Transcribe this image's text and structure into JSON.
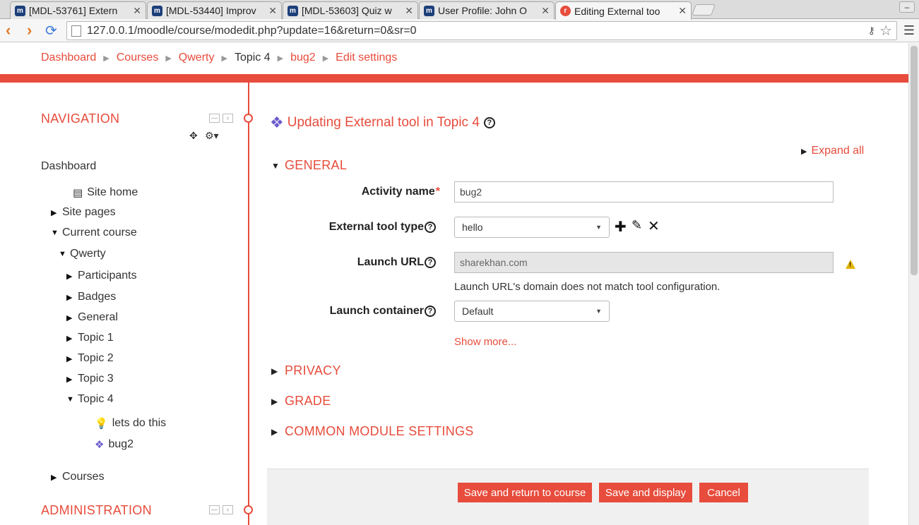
{
  "browser": {
    "tabs": [
      {
        "title": "[MDL-53761] Extern",
        "favicon": "moodle-tracker-icon",
        "active": false
      },
      {
        "title": "[MDL-53440] Improv",
        "favicon": "moodle-tracker-icon",
        "active": false
      },
      {
        "title": "[MDL-53603] Quiz w",
        "favicon": "moodle-tracker-icon",
        "active": false
      },
      {
        "title": "User Profile: John O",
        "favicon": "moodle-tracker-icon",
        "active": false
      },
      {
        "title": "Editing External too",
        "favicon": "moodle-site-icon",
        "active": true
      }
    ],
    "url": "127.0.0.1/moodle/course/modedit.php?update=16&return=0&sr=0"
  },
  "breadcrumb": [
    {
      "label": "Dashboard",
      "link": true
    },
    {
      "label": "Courses",
      "link": true
    },
    {
      "label": "Qwerty",
      "link": true
    },
    {
      "label": "Topic 4",
      "link": false
    },
    {
      "label": "bug2",
      "link": true
    },
    {
      "label": "Edit settings",
      "link": true
    }
  ],
  "navigation": {
    "title": "NAVIGATION",
    "items": {
      "dashboard": "Dashboard",
      "site_home": "Site home",
      "site_pages": "Site pages",
      "current_course": "Current course",
      "qwerty": "Qwerty",
      "participants": "Participants",
      "badges": "Badges",
      "general": "General",
      "topic1": "Topic 1",
      "topic2": "Topic 2",
      "topic3": "Topic 3",
      "topic4": "Topic 4",
      "lets_do_this": "lets do this",
      "bug2": "bug2",
      "courses": "Courses"
    }
  },
  "administration": {
    "title": "ADMINISTRATION"
  },
  "main": {
    "title": "Updating External tool in Topic 4",
    "expand_all": "Expand all",
    "sections": {
      "general": "GENERAL",
      "privacy": "PRIVACY",
      "grade": "GRADE",
      "common": "COMMON MODULE SETTINGS"
    },
    "fields": {
      "activity_name_label": "Activity name",
      "activity_name_value": "bug2",
      "tool_type_label": "External tool type",
      "tool_type_value": "hello",
      "launch_url_label": "Launch URL",
      "launch_url_value": "sharekhan.com",
      "launch_url_note": "Launch URL's domain does not match tool configuration.",
      "launch_container_label": "Launch container",
      "launch_container_value": "Default"
    },
    "show_more": "Show more...",
    "buttons": {
      "save_return": "Save and return to course",
      "save_display": "Save and display",
      "cancel": "Cancel"
    }
  },
  "colors": {
    "accent": "#e74c3c",
    "warning": "#e2b400"
  }
}
